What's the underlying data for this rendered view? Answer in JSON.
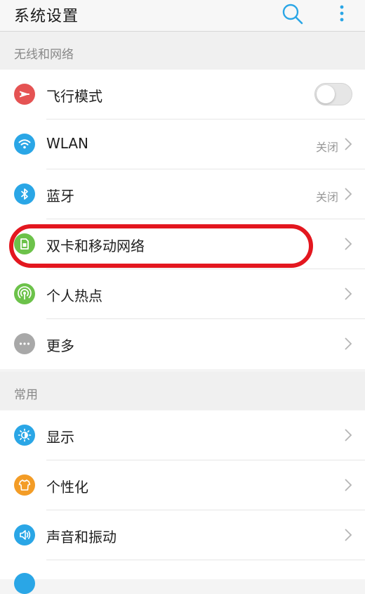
{
  "header": {
    "title": "系统设置",
    "search_icon": "search-icon",
    "more_icon": "more-vertical-icon"
  },
  "sections": [
    {
      "label": "无线和网络",
      "items": [
        {
          "label": "飞行模式",
          "icon": "airplane-icon",
          "color": "#e55353",
          "control": "toggle",
          "toggle_on": false
        },
        {
          "label": "WLAN",
          "icon": "wifi-icon",
          "color": "#2aa6e6",
          "status": "关闭",
          "control": "chevron"
        },
        {
          "label": "蓝牙",
          "icon": "bluetooth-icon",
          "color": "#2aa6e6",
          "status": "关闭",
          "control": "chevron"
        },
        {
          "label": "双卡和移动网络",
          "icon": "sim-card-icon",
          "color": "#6cc24a",
          "control": "chevron",
          "highlighted": true
        },
        {
          "label": "个人热点",
          "icon": "hotspot-icon",
          "color": "#6cc24a",
          "control": "chevron"
        },
        {
          "label": "更多",
          "icon": "more-horizontal-icon",
          "color": "#a8a8a8",
          "control": "chevron"
        }
      ]
    },
    {
      "label": "常用",
      "items": [
        {
          "label": "显示",
          "icon": "brightness-icon",
          "color": "#2aa6e6",
          "control": "chevron"
        },
        {
          "label": "个性化",
          "icon": "tshirt-icon",
          "color": "#f39c26",
          "control": "chevron"
        },
        {
          "label": "声音和振动",
          "icon": "speaker-icon",
          "color": "#2aa6e6",
          "control": "chevron"
        }
      ]
    }
  ],
  "highlight_color": "#e3171f"
}
